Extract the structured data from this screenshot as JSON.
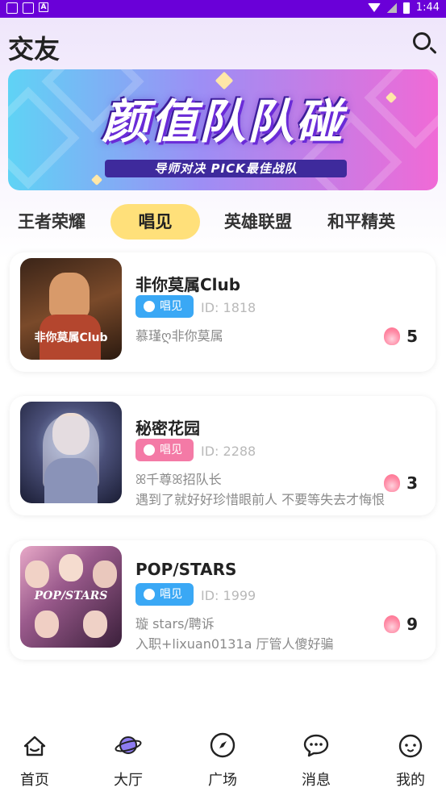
{
  "status_bar": {
    "time": "1:44",
    "notif_letter": "A"
  },
  "header": {
    "title": "交友",
    "search_icon": "search-icon"
  },
  "banner": {
    "title": "颜值队队碰",
    "subtitle": "导师对决 PICK最佳战队"
  },
  "tabs": [
    {
      "label": "王者荣耀",
      "active": false
    },
    {
      "label": "唱见",
      "active": true
    },
    {
      "label": "英雄联盟",
      "active": false
    },
    {
      "label": "和平精英",
      "active": false
    }
  ],
  "rooms": [
    {
      "name": "非你莫属Club",
      "tag": "唱见",
      "tag_color": "#3aa8f5",
      "id": "ID: 1818",
      "host": "慕瑾ღ非你莫属",
      "intro": "",
      "heat": "5",
      "cover_text": "非你莫属Club"
    },
    {
      "name": "秘密花园",
      "tag": "唱见",
      "tag_color": "#f47aa6",
      "id": "ID: 2288",
      "host": "ꕤ千尊ꕤ招队长",
      "intro": "遇到了就好好珍惜眼前人 不要等失去才悔恨",
      "heat": "3",
      "cover_text": ""
    },
    {
      "name": "POP/STARS",
      "tag": "唱见",
      "tag_color": "#3aa8f5",
      "id": "ID: 1999",
      "host": "璇 stars/聘诉",
      "intro": "入职+lixuan0131a 厅管人傻好骗",
      "heat": "9",
      "cover_text": "POP/STARS"
    }
  ],
  "bottom_nav": [
    {
      "label": "首页",
      "icon": "home-icon"
    },
    {
      "label": "大厅",
      "icon": "planet-icon"
    },
    {
      "label": "广场",
      "icon": "compass-icon"
    },
    {
      "label": "消息",
      "icon": "chat-bubble-icon"
    },
    {
      "label": "我的",
      "icon": "profile-face-icon"
    }
  ]
}
